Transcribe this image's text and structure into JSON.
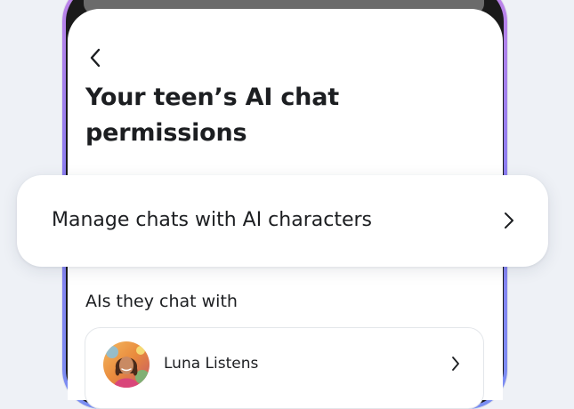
{
  "page": {
    "title": "Your teen’s AI chat permissions",
    "back_icon": "chevron-left-icon"
  },
  "manage_card": {
    "label": "Manage chats with AI characters",
    "chevron_icon": "chevron-right-icon"
  },
  "ai_section": {
    "heading": "AIs they chat with",
    "items": [
      {
        "name": "Luna Listens",
        "avatar_icon": "avatar-image",
        "chevron_icon": "chevron-right-icon"
      }
    ]
  },
  "colors": {
    "background": "#eef1f6",
    "text": "#1c1e21",
    "frame_gradient_top": "#c084e8",
    "frame_gradient_bottom": "#7a8ef2"
  }
}
